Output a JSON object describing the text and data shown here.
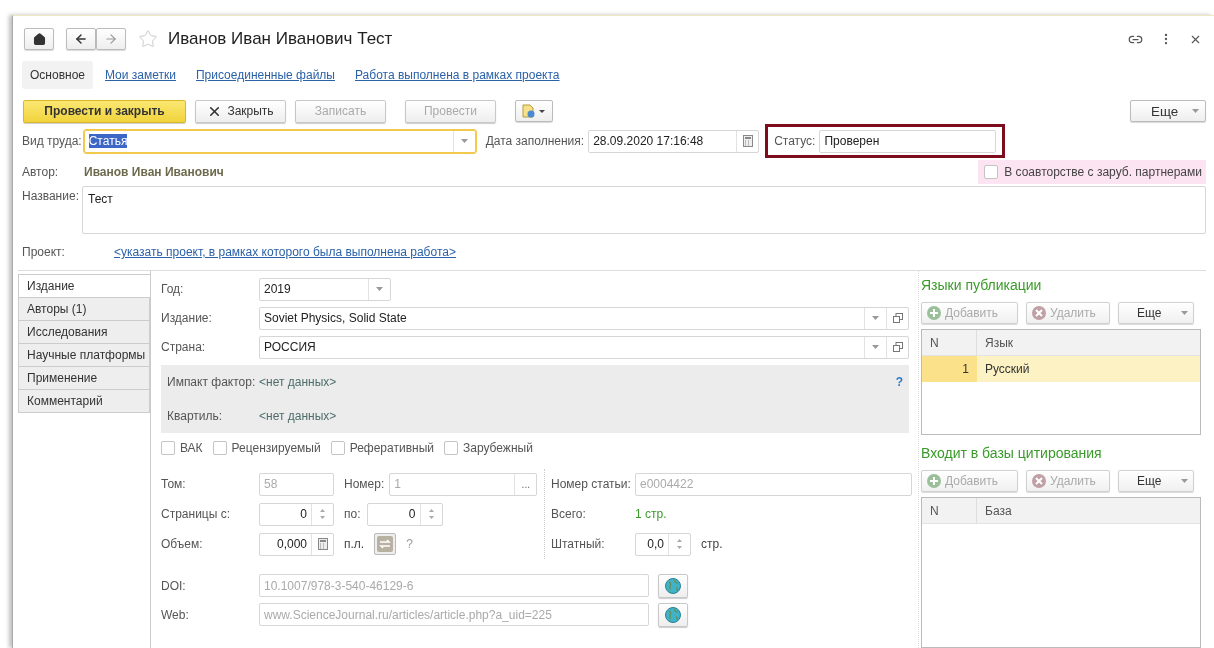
{
  "window": {
    "title": "Иванов Иван Иванович Тест"
  },
  "nav_tabs": [
    {
      "label": "Основное",
      "selected": true
    },
    {
      "label": "Мои заметки",
      "selected": false
    },
    {
      "label": "Присоединенные файлы",
      "selected": false
    },
    {
      "label": "Работа выполнена в рамках проекта",
      "selected": false
    }
  ],
  "toolbar": {
    "buttons": [
      {
        "label": "Провести и закрыть",
        "kind": "default",
        "disabled": false
      },
      {
        "label": "Закрыть",
        "kind": "close",
        "disabled": false
      },
      {
        "label": "Записать",
        "kind": "plain",
        "disabled": true
      },
      {
        "label": "Провести",
        "kind": "plain",
        "disabled": true
      }
    ],
    "more": "Еще"
  },
  "header_form": {
    "work_type": {
      "label": "Вид труда:",
      "value": "Статья"
    },
    "fill_date": {
      "label": "Дата заполнения:",
      "value": "28.09.2020 17:16:48"
    },
    "status": {
      "label": "Статус:",
      "value": "Проверен",
      "highlighted": true
    },
    "author": {
      "label": "Автор:",
      "value": "Иванов Иван Иванович"
    },
    "foreign_coauthors": {
      "label": "В соавторстве с заруб. партнерами",
      "checked": false
    },
    "name": {
      "label": "Название:",
      "value": "Тест"
    },
    "project": {
      "label": "Проект:",
      "link": "<указать проект, в рамках которого была выполнена работа>"
    }
  },
  "side_tabs": [
    {
      "label": "Издание",
      "selected": true
    },
    {
      "label": "Авторы (1)",
      "selected": false
    },
    {
      "label": "Исследования",
      "selected": false
    },
    {
      "label": "Научные платформы",
      "selected": false
    },
    {
      "label": "Применение",
      "selected": false
    },
    {
      "label": "Комментарий",
      "selected": false
    }
  ],
  "publication": {
    "year": {
      "label": "Год:",
      "value": "2019"
    },
    "edition": {
      "label": "Издание:",
      "value": "Soviet Physics, Solid State"
    },
    "country": {
      "label": "Страна:",
      "value": "РОССИЯ"
    },
    "impact": {
      "label": "Импакт фактор:",
      "value": "<нет данных>",
      "help": "?"
    },
    "quartile": {
      "label": "Квартиль:",
      "value": "<нет данных>"
    },
    "flags": [
      {
        "label": "ВАК",
        "checked": false
      },
      {
        "label": "Рецензируемый",
        "checked": false
      },
      {
        "label": "Реферативный",
        "checked": false
      },
      {
        "label": "Зарубежный",
        "checked": false
      }
    ],
    "volume": {
      "label": "Том:",
      "value": "58",
      "disabled": true
    },
    "number": {
      "label": "Номер:",
      "value": "1",
      "disabled": true,
      "button": "..."
    },
    "article_number": {
      "label": "Номер статьи:",
      "value": "e0004422",
      "disabled": true
    },
    "pages_from": {
      "label": "Страницы с:",
      "value": "0"
    },
    "pages_to": {
      "label": "по:",
      "value": "0"
    },
    "total": {
      "label": "Всего:",
      "value": "1 стр."
    },
    "size": {
      "label": "Объем:",
      "value": "0,000",
      "unit": "п.л.",
      "help": "?"
    },
    "staff": {
      "label": "Штатный:",
      "value": "0,0",
      "unit": "стр."
    },
    "doi": {
      "label": "DOI:",
      "value": "10.1007/978-3-540-46129-6",
      "disabled": true
    },
    "web": {
      "label": "Web:",
      "value": "www.ScienceJournal.ru/articles/article.php?a_uid=225",
      "disabled": true
    }
  },
  "languages": {
    "title": "Языки публикации",
    "buttons": [
      {
        "label": "Добавить",
        "kind": "add",
        "disabled": true
      },
      {
        "label": "Удалить",
        "kind": "delete",
        "disabled": true
      }
    ],
    "more": "Еще",
    "columns": [
      "N",
      "Язык"
    ],
    "rows": [
      {
        "cells": [
          "1",
          "Русский"
        ],
        "selected": true
      }
    ]
  },
  "citation_bases": {
    "title": "Входит в базы цитирования",
    "buttons": [
      {
        "label": "Добавить",
        "kind": "add",
        "disabled": true
      },
      {
        "label": "Удалить",
        "kind": "delete",
        "disabled": true
      }
    ],
    "more": "Еще",
    "columns": [
      "N",
      "База"
    ]
  }
}
